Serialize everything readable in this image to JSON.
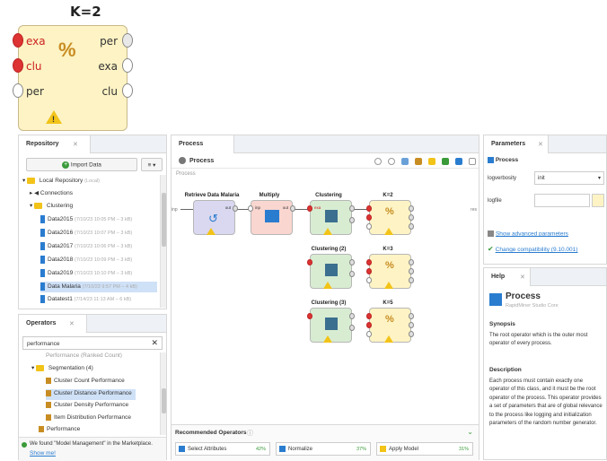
{
  "big_operator": {
    "title": "K=2",
    "inputs": [
      "exa",
      "clu",
      "per"
    ],
    "outputs": [
      "per",
      "exa",
      "clu"
    ],
    "icon": "percent-icon"
  },
  "repository": {
    "tab": "Repository",
    "import_button": "Import Data",
    "menu_button": "≡ ▾",
    "root": "Local Repository",
    "root_note": "(Local)",
    "items": [
      {
        "label": "Connections",
        "type": "folder"
      },
      {
        "label": "Clustering",
        "type": "folder"
      },
      {
        "label": "Data2015",
        "meta": "(7/10/23 10:05 PM – 3 kB)"
      },
      {
        "label": "Data2016",
        "meta": "(7/10/23 10:07 PM – 3 kB)"
      },
      {
        "label": "Data2017",
        "meta": "(7/10/23 10:06 PM – 3 kB)"
      },
      {
        "label": "Data2018",
        "meta": "(7/10/23 10:09 PM – 3 kB)"
      },
      {
        "label": "Data2019",
        "meta": "(7/10/23 10:10 PM – 3 kB)"
      },
      {
        "label": "Data Malaria",
        "meta": "(7/10/23 9:57 PM – 4 kB)"
      },
      {
        "label": "Datatest1",
        "meta": "(7/14/23 11:13 AM – 6 kB)"
      }
    ]
  },
  "operators": {
    "tab": "Operators",
    "search_value": "performance",
    "items": [
      {
        "label": "Performance (Ranked Count)"
      },
      {
        "label": "Segmentation (4)",
        "type": "folder"
      },
      {
        "label": "Cluster Count Performance"
      },
      {
        "label": "Cluster Distance Performance"
      },
      {
        "label": "Cluster Density Performance"
      },
      {
        "label": "Item Distribution Performance"
      },
      {
        "label": "Performance",
        "type": "folder"
      }
    ],
    "marketplace_text": "We found \"Model Management\" in the Marketplace.",
    "marketplace_link": "Show me!"
  },
  "process": {
    "tab": "Process",
    "breadcrumb": "Process",
    "canvas_label": "Process",
    "inp": "inp",
    "res": "res",
    "operators": [
      {
        "title": "Retrieve Data Malaria"
      },
      {
        "title": "Multiply"
      },
      {
        "title": "Clustering"
      },
      {
        "title": "K=2"
      },
      {
        "title": "Clustering (2)"
      },
      {
        "title": "K=3"
      },
      {
        "title": "Clustering (3)"
      },
      {
        "title": "K=5"
      }
    ],
    "port_labels": {
      "out": "out",
      "inp": "inp",
      "exa": "exa",
      "clu": "clu",
      "per": "per"
    }
  },
  "recommended": {
    "title": "Recommended Operators",
    "items": [
      {
        "label": "Select Attributes",
        "pct": "42%"
      },
      {
        "label": "Normalize",
        "pct": "37%"
      },
      {
        "label": "Apply Model",
        "pct": "31%"
      }
    ]
  },
  "parameters": {
    "tab": "Parameters",
    "process_label": "Process",
    "rows": [
      {
        "label": "logverbosity",
        "value": "init"
      },
      {
        "label": "logfile",
        "value": ""
      }
    ],
    "advanced_link": "Show advanced parameters",
    "compat_link": "Change compatibility (9.10.001)"
  },
  "help": {
    "tab": "Help",
    "title": "Process",
    "subtitle": "RapidMiner Studio Core",
    "synopsis_head": "Synopsis",
    "synopsis": "The root operator which is the outer most operator of every process.",
    "description_head": "Description",
    "description": "Each process must contain exactly one operator of this class, and it must be the root operator of the process. This operator provides a set of parameters that are of global relevance to the process like logging and initialization parameters of the random number generator."
  },
  "colors": {
    "accent": "#2a7ccf",
    "warning": "#f2c318",
    "operator_yellow": "#fdf3c4",
    "operator_green": "#d8ecd2",
    "port_red": "#d33333"
  }
}
